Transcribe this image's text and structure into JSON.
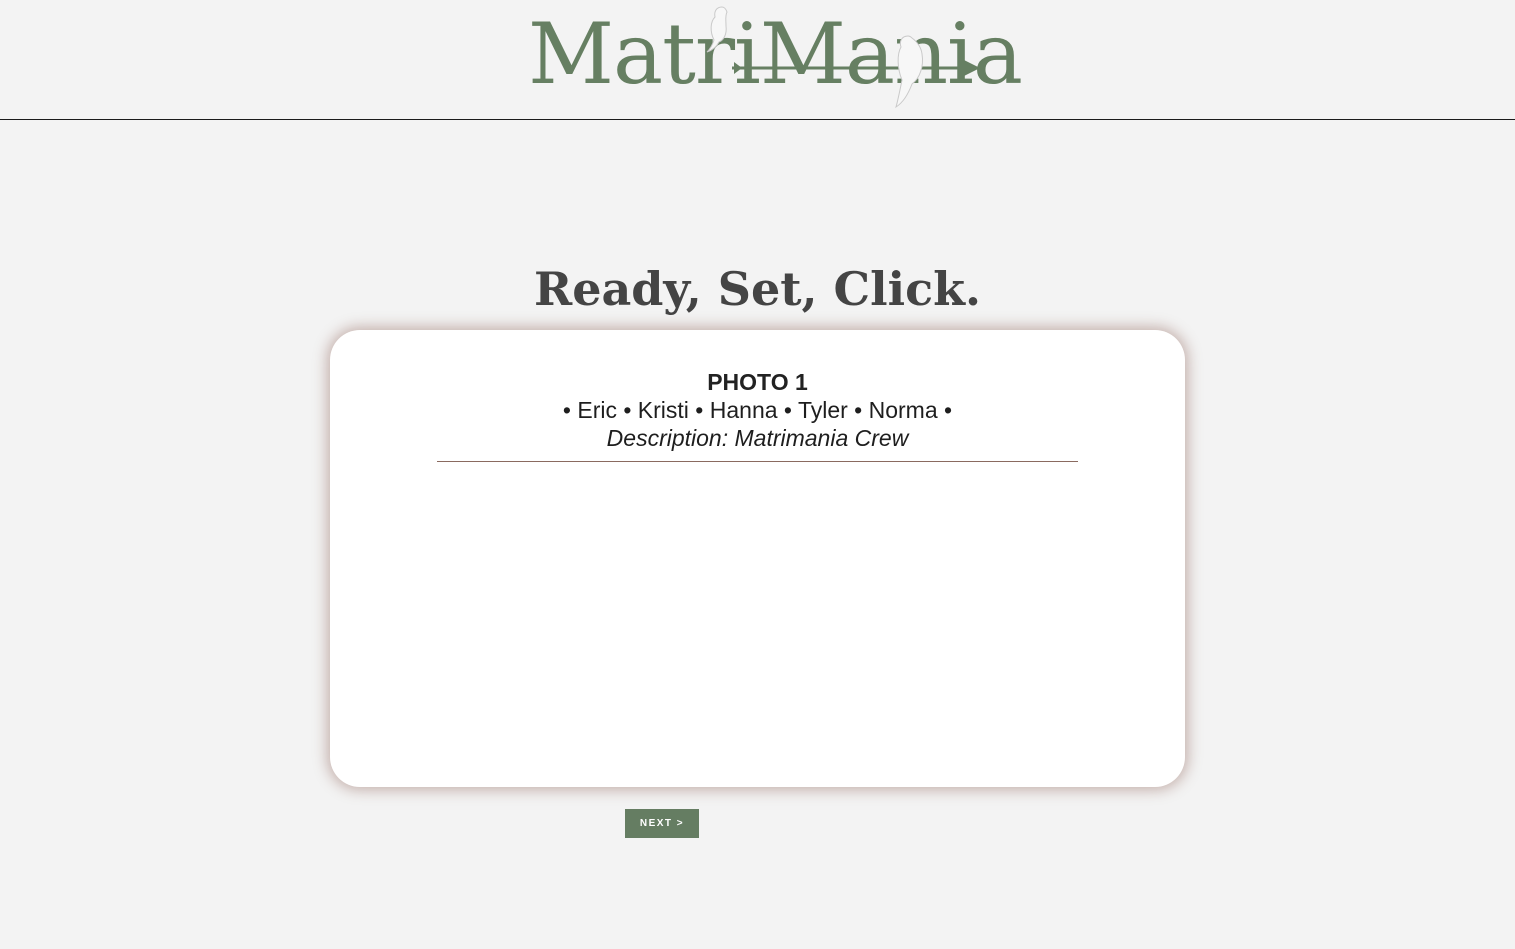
{
  "header": {
    "logo_text": "MatriMania",
    "brand_color": "#667f62",
    "logo_icons": [
      "bird-icon",
      "bird-icon",
      "arrow-icon"
    ]
  },
  "main": {
    "title": "Ready, Set, Click."
  },
  "card": {
    "photo_label": "PHOTO 1",
    "people_line": "• Eric • Kristi • Hanna • Tyler • Norma •",
    "description": "Description: Matrimania Crew"
  },
  "actions": {
    "next_label": "NEXT >"
  },
  "colors": {
    "background": "#f3f3f3",
    "button": "#657d62",
    "card_shadow": "#8c5f55",
    "title": "#444444"
  }
}
